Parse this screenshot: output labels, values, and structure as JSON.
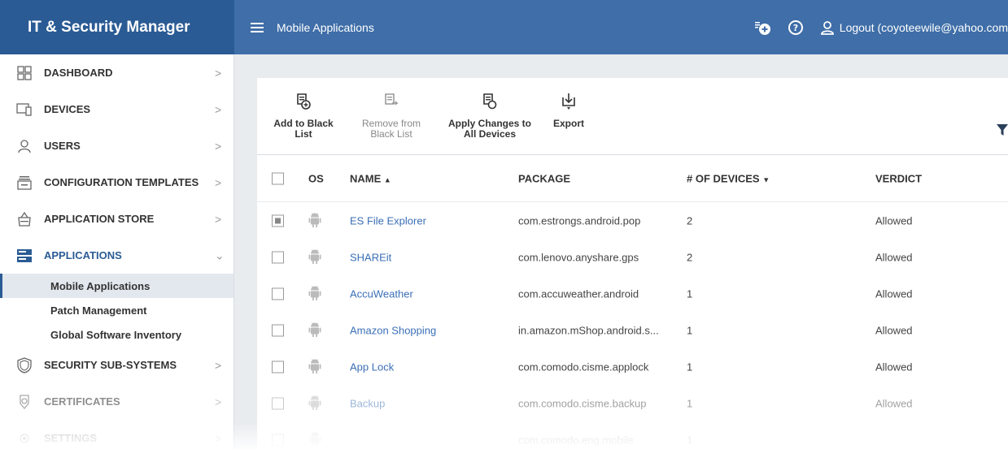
{
  "app": {
    "title": "IT & Security Manager"
  },
  "header": {
    "page_title": "Mobile Applications",
    "logout_label": "Logout (coyoteewile@yahoo.com"
  },
  "sidebar": {
    "items": [
      {
        "label": "DASHBOARD",
        "icon": "dashboard-icon"
      },
      {
        "label": "DEVICES",
        "icon": "devices-icon"
      },
      {
        "label": "USERS",
        "icon": "user-icon"
      },
      {
        "label": "CONFIGURATION TEMPLATES",
        "icon": "templates-icon"
      },
      {
        "label": "APPLICATION STORE",
        "icon": "store-icon"
      },
      {
        "label": "APPLICATIONS",
        "icon": "applications-icon"
      },
      {
        "label": "SECURITY SUB-SYSTEMS",
        "icon": "shield-icon"
      },
      {
        "label": "CERTIFICATES",
        "icon": "certificate-icon"
      },
      {
        "label": "SETTINGS",
        "icon": "settings-icon"
      }
    ],
    "sub_items": [
      {
        "label": "Mobile Applications",
        "active": true
      },
      {
        "label": "Patch Management",
        "active": false
      },
      {
        "label": "Global Software Inventory",
        "active": false
      }
    ]
  },
  "toolbar": {
    "add_black_list": "Add to Black List",
    "remove_black_list_1": "Remove from",
    "remove_black_list_2": "Black List",
    "apply_changes_1": "Apply Changes to",
    "apply_changes_2": "All Devices",
    "export": "Export"
  },
  "table": {
    "headers": {
      "os": "OS",
      "name": "NAME",
      "name_sort": "▲",
      "package": "PACKAGE",
      "devices": "# OF DEVICES",
      "devices_sort": "▼",
      "verdict": "VERDICT"
    },
    "rows": [
      {
        "name": "ES File Explorer",
        "package": "com.estrongs.android.pop",
        "devices": "2",
        "verdict": "Allowed",
        "checked": "partial"
      },
      {
        "name": "SHAREit",
        "package": "com.lenovo.anyshare.gps",
        "devices": "2",
        "verdict": "Allowed",
        "checked": "no"
      },
      {
        "name": "AccuWeather",
        "package": "com.accuweather.android",
        "devices": "1",
        "verdict": "Allowed",
        "checked": "no"
      },
      {
        "name": "Amazon Shopping",
        "package": "in.amazon.mShop.android.s...",
        "devices": "1",
        "verdict": "Allowed",
        "checked": "no"
      },
      {
        "name": "App Lock",
        "package": "com.comodo.cisme.applock",
        "devices": "1",
        "verdict": "Allowed",
        "checked": "no"
      },
      {
        "name": "Backup",
        "package": "com.comodo.cisme.backup",
        "devices": "1",
        "verdict": "Allowed",
        "checked": "no"
      },
      {
        "name": "",
        "package": "com.comodo.eng.mobile",
        "devices": "1",
        "verdict": "",
        "checked": "no"
      }
    ]
  },
  "colors": {
    "brand": "#2a5b94",
    "topbar": "#3f6ea8",
    "link": "#3b6fb6"
  }
}
